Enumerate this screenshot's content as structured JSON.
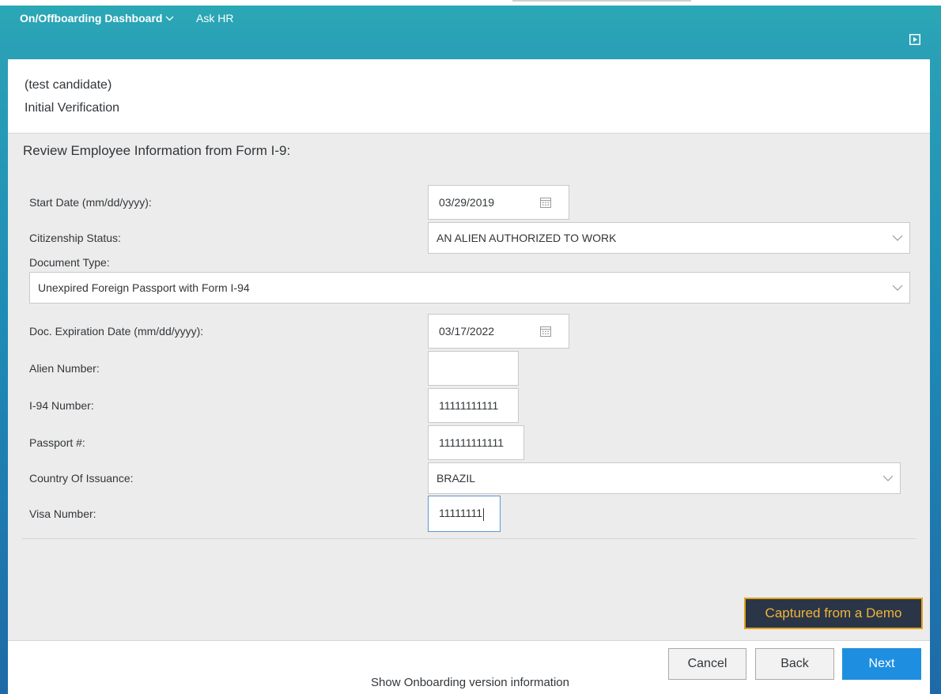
{
  "shell": {
    "menu_label": "On/Offboarding Dashboard",
    "ask_hr": "Ask HR"
  },
  "header": {
    "candidate": "(test candidate)",
    "step": "Initial Verification"
  },
  "section": {
    "title": "Review Employee Information from Form I-9:"
  },
  "form": {
    "start_date": {
      "label": "Start Date (mm/dd/yyyy):",
      "value": "03/29/2019"
    },
    "citizenship": {
      "label": "Citizenship Status:",
      "value": "AN ALIEN AUTHORIZED TO WORK"
    },
    "document_type": {
      "label": "Document Type:",
      "value": "Unexpired Foreign Passport with Form I-94"
    },
    "doc_expiration": {
      "label": "Doc. Expiration Date (mm/dd/yyyy):",
      "value": "03/17/2022"
    },
    "alien_number": {
      "label": "Alien Number:",
      "value": ""
    },
    "i94_number": {
      "label": "I-94 Number:",
      "value": "11111111111"
    },
    "passport": {
      "label": "Passport #:",
      "value": "111111111111"
    },
    "country": {
      "label": "Country Of Issuance:",
      "value": "BRAZIL"
    },
    "visa": {
      "label": "Visa Number:",
      "value": "11111111"
    }
  },
  "demo_badge": "Captured from a Demo",
  "footer": {
    "cancel": "Cancel",
    "back": "Back",
    "next": "Next",
    "version": "Show Onboarding version information"
  },
  "colors": {
    "accent": "#1e8fe0",
    "shell": "#2aa9b5",
    "badge_bg": "#2a3547",
    "badge_text": "#f1b43a"
  },
  "icons": [
    "chevron-down-icon",
    "play-icon",
    "calendar-icon"
  ]
}
